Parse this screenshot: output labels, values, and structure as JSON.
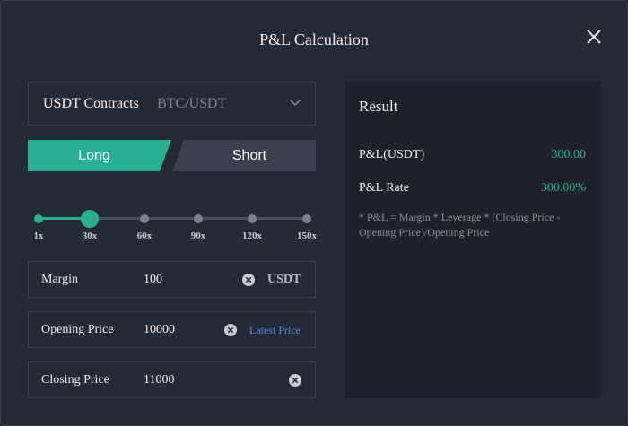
{
  "title": "P&L Calculation",
  "contract_select": {
    "type": "USDT Contracts",
    "pair": "BTC/USDT"
  },
  "tabs": {
    "long": "Long",
    "short": "Short",
    "active": "long"
  },
  "leverage": {
    "ticks": [
      "1x",
      "30x",
      "60x",
      "90x",
      "120x",
      "150x"
    ],
    "selected": "30x"
  },
  "fields": {
    "margin": {
      "label": "Margin",
      "value": "100",
      "unit": "USDT"
    },
    "opening_price": {
      "label": "Opening Price",
      "value": "10000",
      "link": "Latest Price"
    },
    "closing_price": {
      "label": "Closing Price",
      "value": "11000"
    }
  },
  "result": {
    "title": "Result",
    "pnl_label": "P&L(USDT)",
    "pnl_value": "300.00",
    "rate_label": "P&L Rate",
    "rate_value": "300.00%",
    "formula": "* P&L = Margin * Leverage * (Closing Price - Opening Price)/Opening Price"
  },
  "colors": {
    "accent": "#27b092",
    "link": "#4f8fe0",
    "background": "#242a35",
    "panel": "#1d2129"
  },
  "icons": {
    "close": "close-icon",
    "dropdown": "chevron-down-icon",
    "clear": "clear-icon"
  }
}
